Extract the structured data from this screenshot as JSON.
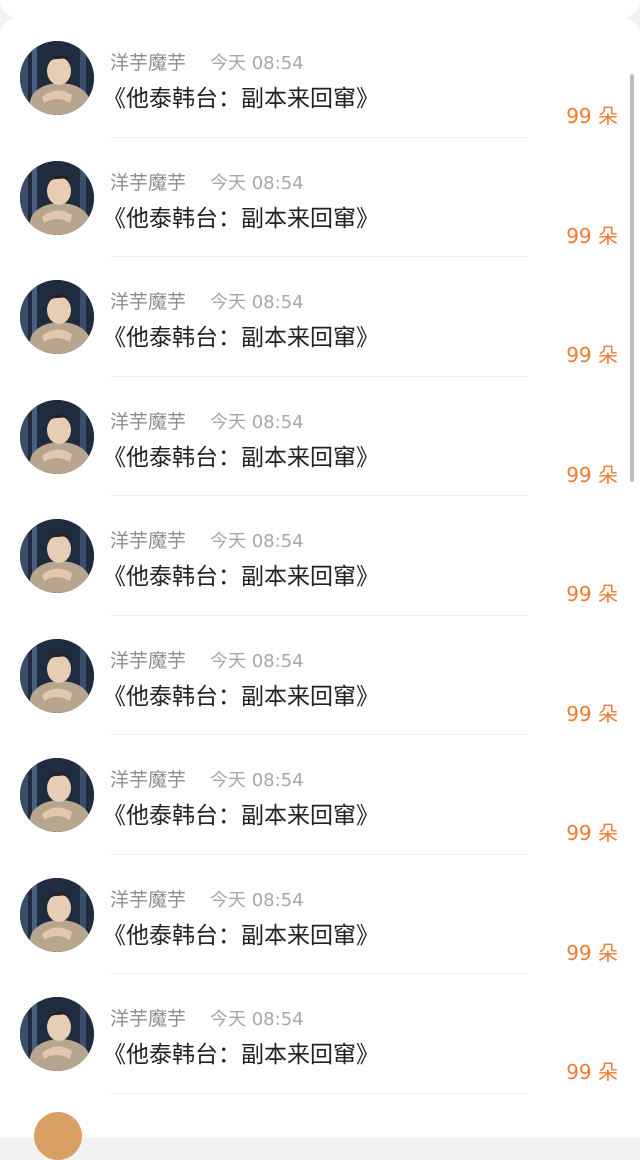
{
  "feed": {
    "items": [
      {
        "username": "洋芋魔芋",
        "timestamp": "今天 08:54",
        "title": "《他泰韩台：副本来回窜》",
        "amount": "99 朵"
      },
      {
        "username": "洋芋魔芋",
        "timestamp": "今天 08:54",
        "title": "《他泰韩台：副本来回窜》",
        "amount": "99 朵"
      },
      {
        "username": "洋芋魔芋",
        "timestamp": "今天 08:54",
        "title": "《他泰韩台：副本来回窜》",
        "amount": "99 朵"
      },
      {
        "username": "洋芋魔芋",
        "timestamp": "今天 08:54",
        "title": "《他泰韩台：副本来回窜》",
        "amount": "99 朵"
      },
      {
        "username": "洋芋魔芋",
        "timestamp": "今天 08:54",
        "title": "《他泰韩台：副本来回窜》",
        "amount": "99 朵"
      },
      {
        "username": "洋芋魔芋",
        "timestamp": "今天 08:54",
        "title": "《他泰韩台：副本来回窜》",
        "amount": "99 朵"
      },
      {
        "username": "洋芋魔芋",
        "timestamp": "今天 08:54",
        "title": "《他泰韩台：副本来回窜》",
        "amount": "99 朵"
      },
      {
        "username": "洋芋魔芋",
        "timestamp": "今天 08:54",
        "title": "《他泰韩台：副本来回窜》",
        "amount": "99 朵"
      },
      {
        "username": "洋芋魔芋",
        "timestamp": "今天 08:54",
        "title": "《他泰韩台：副本来回窜》",
        "amount": "99 朵"
      }
    ]
  },
  "colors": {
    "accent": "#f07a2f",
    "username": "#8e8e8e",
    "timestamp": "#a8a8a8",
    "title": "#222222",
    "background": "#f2f2f2"
  }
}
